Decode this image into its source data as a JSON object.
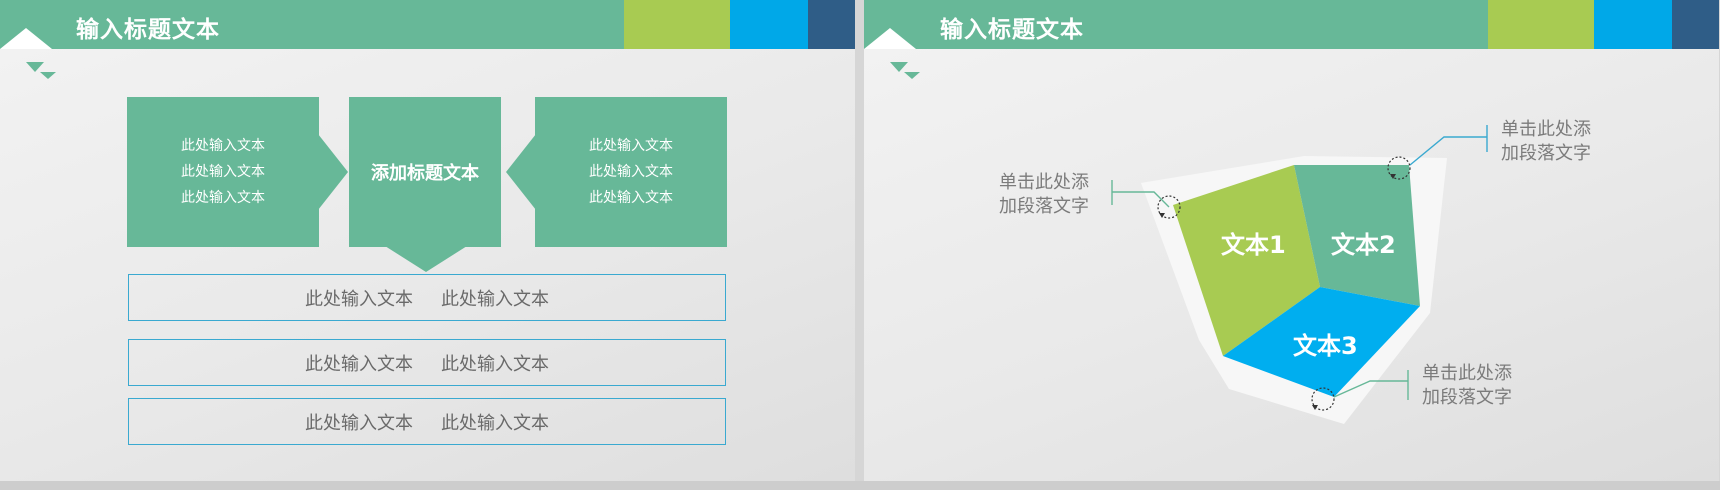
{
  "left_slide": {
    "title": "输入标题文本",
    "header_colors": [
      "#a8cb52",
      "#00a8e8",
      "#2f5d87"
    ],
    "left_box": [
      "此处输入文本",
      "此处输入文本",
      "此处输入文本"
    ],
    "center_box": "添加标题文本",
    "right_box": [
      "此处输入文本",
      "此处输入文本",
      "此处输入文本"
    ],
    "rows": [
      [
        "此处输入文本",
        "此处输入文本"
      ],
      [
        "此处输入文本",
        "此处输入文本"
      ],
      [
        "此处输入文本",
        "此处输入文本"
      ]
    ]
  },
  "right_slide": {
    "title": "输入标题文本",
    "segments": [
      {
        "label": "文本1",
        "color": "#a8cb52"
      },
      {
        "label": "文本2",
        "color": "#67b898"
      },
      {
        "label": "文本3",
        "color": "#00aeef"
      }
    ],
    "callouts": [
      [
        "单击此处添",
        "加段落文字"
      ],
      [
        "单击此处添",
        "加段落文字"
      ],
      [
        "单击此处添",
        "加段落文字"
      ]
    ]
  }
}
